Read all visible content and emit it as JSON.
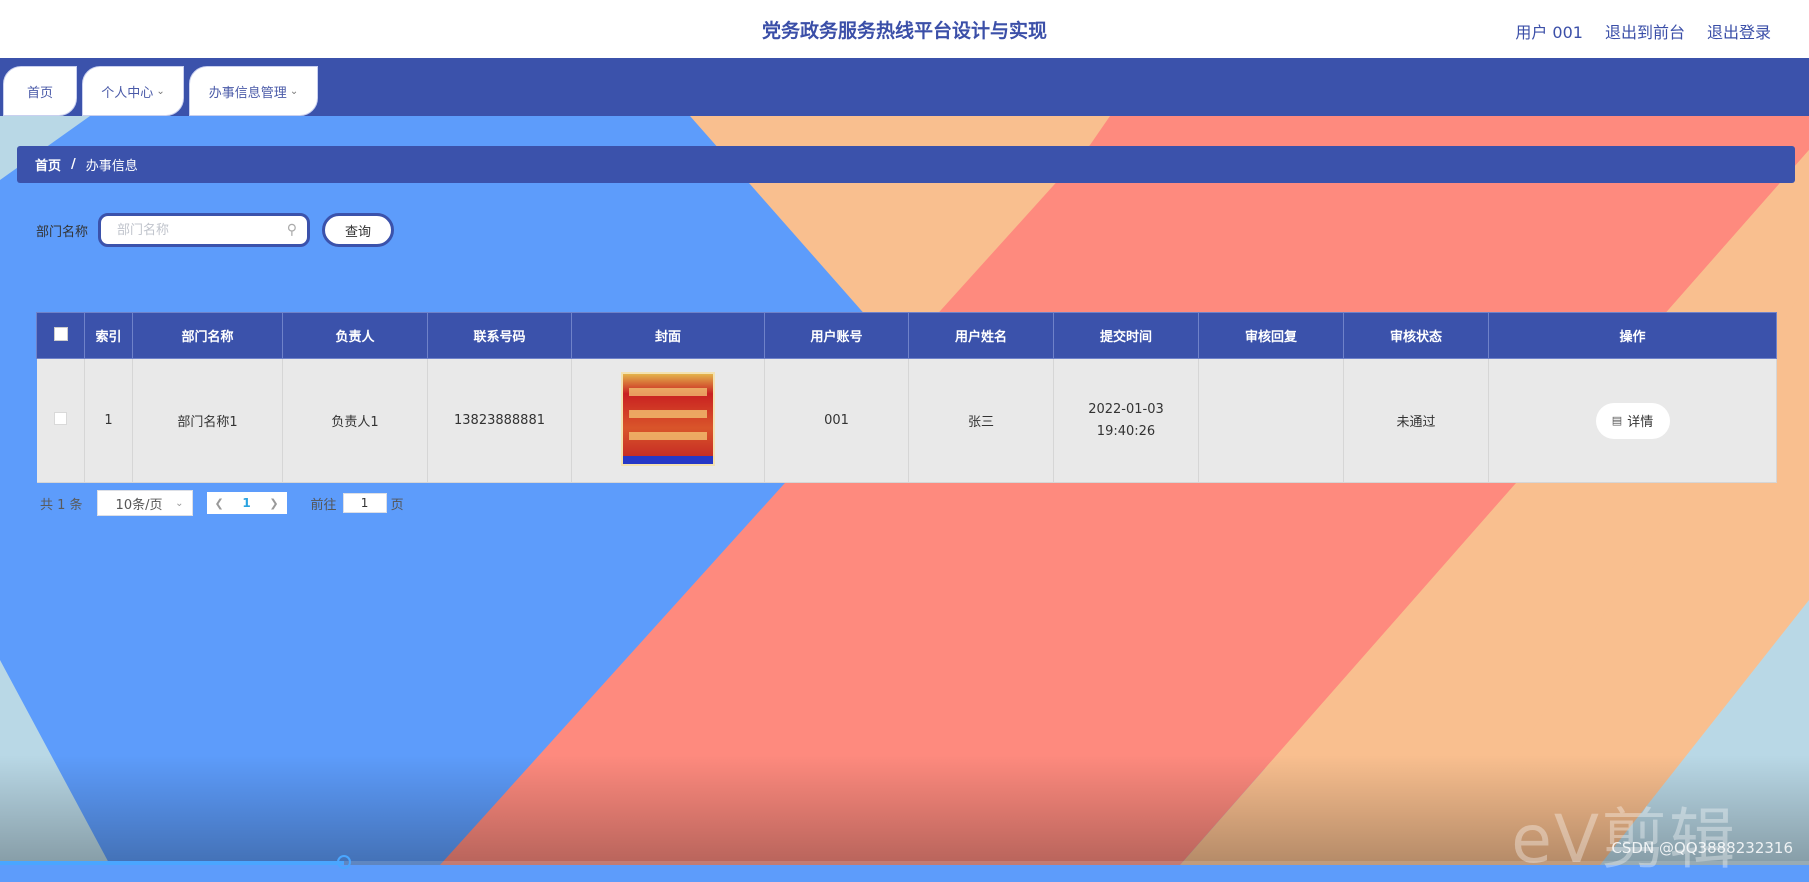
{
  "header": {
    "title": "党务政务服务热线平台设计与实现",
    "links": [
      "用户 001",
      "退出到前台",
      "退出登录"
    ]
  },
  "nav": {
    "tabs": [
      {
        "label": "首页",
        "has_dropdown": false
      },
      {
        "label": "个人中心",
        "has_dropdown": true
      },
      {
        "label": "办事信息管理",
        "has_dropdown": true
      }
    ]
  },
  "breadcrumb": {
    "home": "首页",
    "separator": "/",
    "current": "办事信息"
  },
  "search": {
    "label": "部门名称",
    "placeholder": "部门名称",
    "value": "",
    "button": "查询"
  },
  "table": {
    "columns": [
      "索引",
      "部门名称",
      "负责人",
      "联系号码",
      "封面",
      "用户账号",
      "用户姓名",
      "提交时间",
      "审核回复",
      "审核状态",
      "操作"
    ],
    "rows": [
      {
        "index": "1",
        "dept": "部门名称1",
        "leader": "负责人1",
        "phone": "13823888881",
        "cover_icon": "poster-image",
        "account": "001",
        "name": "张三",
        "time": "2022-01-03 19:40:26",
        "reply": "",
        "status": "未通过",
        "action": "详情"
      }
    ]
  },
  "pagination": {
    "total": "共 1 条",
    "page_size": "10条/页",
    "current_page": "1",
    "goto_label": "前往",
    "goto_value": "1",
    "page_unit": "页"
  },
  "overlay": {
    "watermark": "eV剪辑",
    "credit": "CSDN @QQ3888232316",
    "video_progress": 0.19
  },
  "colors": {
    "primary": "#3b52ab",
    "bg_blue": "#5d9cfb",
    "bg_peach": "#f9bf8f",
    "bg_salmon": "#fe8a7e",
    "bg_pale": "#b9d8e6"
  }
}
